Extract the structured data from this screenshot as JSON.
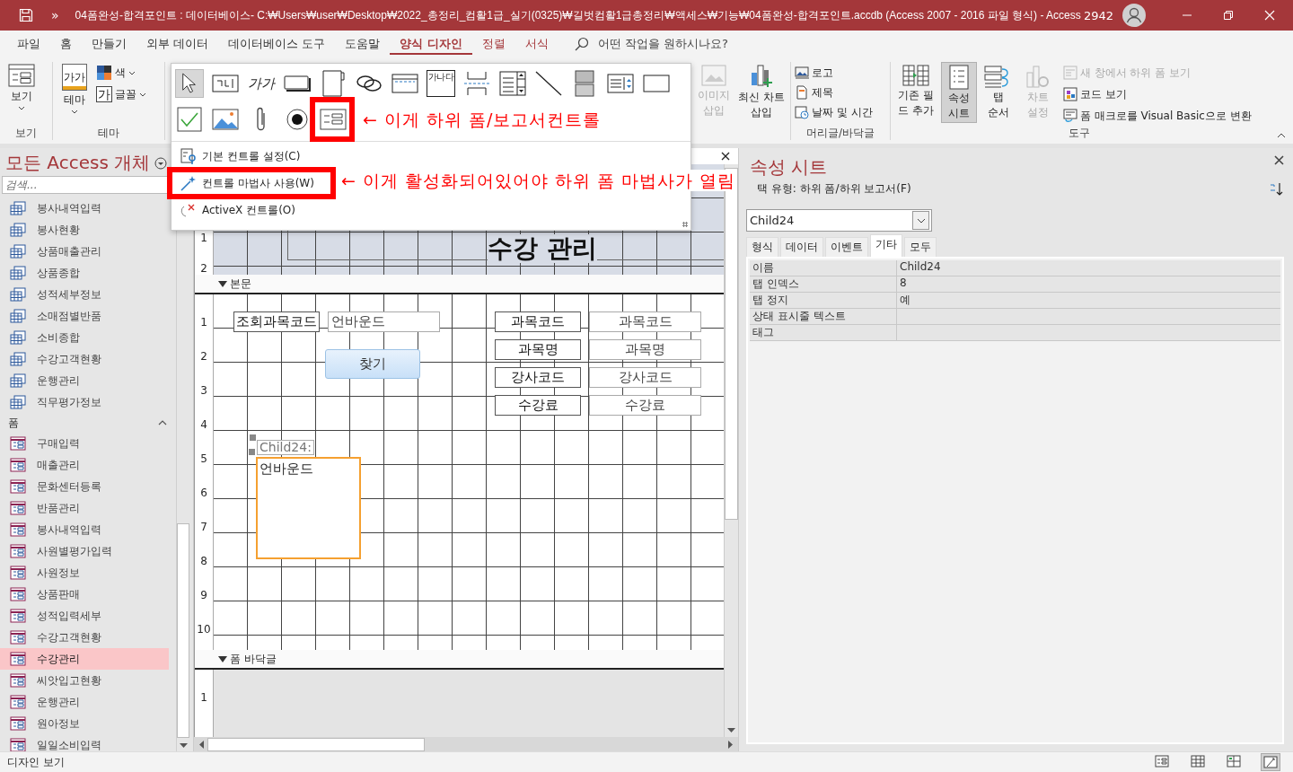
{
  "window": {
    "title": "04폼완성-합격포인트 : 데이터베이스- C:₩Users₩user₩Desktop₩2022_총정리_컴활1급_실기(0325)₩길벗컴활1급총정리₩액세스₩기능₩04폼완성-합격포인트.accdb (Access 2007 - 2016 파일 형식)  -  Access",
    "user_count": "2942",
    "more": "»"
  },
  "menu_tabs": [
    {
      "label": "파일",
      "selected": false,
      "contextual": false
    },
    {
      "label": "홈",
      "selected": false,
      "contextual": false
    },
    {
      "label": "만들기",
      "selected": false,
      "contextual": false
    },
    {
      "label": "외부 데이터",
      "selected": false,
      "contextual": false
    },
    {
      "label": "데이터베이스 도구",
      "selected": false,
      "contextual": false
    },
    {
      "label": "도움말",
      "selected": false,
      "contextual": false
    },
    {
      "label": "양식 디자인",
      "selected": true,
      "contextual": true
    },
    {
      "label": "정렬",
      "selected": false,
      "contextual": true
    },
    {
      "label": "서식",
      "selected": false,
      "contextual": true
    }
  ],
  "tell_me": {
    "placeholder": "어떤 작업을 원하시나요?"
  },
  "ribbon": {
    "view": {
      "button": "보기",
      "label": "보기"
    },
    "theme": {
      "button": "테마",
      "icon_text": "가가",
      "colors": "색",
      "fonts": "글꼴",
      "fonts_icon_text": "가",
      "label": "테마"
    },
    "insert": [
      {
        "lines": [
          "이미지",
          "삽입"
        ],
        "kind": "image",
        "disabled": true
      },
      {
        "lines": [
          "최신 차트",
          "삽입"
        ],
        "kind": "chart",
        "disabled": false
      }
    ],
    "header_footer": {
      "items": [
        {
          "label": "로고",
          "kind": "logo"
        },
        {
          "label": "제목",
          "kind": "title"
        },
        {
          "label": "날짜 및 시간",
          "kind": "date"
        }
      ],
      "label": "머리글/바닥글"
    },
    "tools": {
      "big": [
        {
          "lines": [
            "기존 필",
            "드 추가"
          ],
          "kind": "fields",
          "selected": false,
          "disabled": false
        },
        {
          "lines": [
            "속성",
            "시트"
          ],
          "kind": "sheet",
          "selected": true,
          "disabled": false
        },
        {
          "lines": [
            "탭",
            "순서"
          ],
          "kind": "taborder",
          "selected": false,
          "disabled": false
        },
        {
          "lines": [
            "차트",
            "설정"
          ],
          "kind": "chart",
          "selected": false,
          "disabled": true
        }
      ],
      "small": [
        {
          "label": "새 창에서 하위 폼 보기",
          "kind": "subwin",
          "disabled": true
        },
        {
          "label": "코드 보기",
          "kind": "code",
          "disabled": false
        },
        {
          "label": "폼 매크로를 Visual Basic으로 변환",
          "kind": "convert",
          "disabled": false
        }
      ],
      "label": "도구"
    }
  },
  "controls_popup": {
    "rows": [
      [
        {
          "kind": "pointer",
          "selected": true
        },
        {
          "kind": "label",
          "selected": false
        },
        {
          "kind": "textbox",
          "text": "가가",
          "selected": false
        },
        {
          "kind": "button",
          "selected": false
        },
        {
          "kind": "tab",
          "selected": false
        },
        {
          "kind": "link",
          "selected": false
        },
        {
          "kind": "nav",
          "selected": false
        },
        {
          "kind": "optiongroup",
          "text": "가나다",
          "selected": false
        },
        {
          "kind": "pagebreak",
          "selected": false
        },
        {
          "kind": "combo",
          "selected": false
        },
        {
          "kind": "line",
          "selected": false
        },
        {
          "kind": "toggle",
          "selected": false
        },
        {
          "kind": "listbox",
          "selected": false
        },
        {
          "kind": "rect",
          "selected": false
        }
      ],
      [
        {
          "kind": "checkbox",
          "selected": false
        },
        {
          "kind": "image",
          "selected": false
        },
        {
          "kind": "attachment",
          "selected": false
        },
        {
          "kind": "option",
          "selected": false
        },
        {
          "kind": "subform",
          "selected": false
        }
      ]
    ],
    "menu": [
      {
        "label": "기본 컨트롤 설정(C)",
        "kind": "settings"
      },
      {
        "label": "컨트롤 마법사 사용(W)",
        "kind": "wizard"
      },
      {
        "label": "ActiveX 컨트롤(O)",
        "kind": "activex"
      }
    ]
  },
  "annotations": [
    {
      "text": "← 이게 하위 폼/보고서컨트롤"
    },
    {
      "text": "← 이게 활성화되어있어야 하위 폼 마법사가 열림"
    }
  ],
  "nav": {
    "title": "모든 Access 개체",
    "search": {
      "placeholder": "검색..."
    },
    "groups": [
      {
        "kind": "query",
        "items": [
          {
            "label": "봉사내역입력",
            "selected": false
          },
          {
            "label": "봉사현황",
            "selected": false
          },
          {
            "label": "상품매출관리",
            "selected": false
          },
          {
            "label": "상품종합",
            "selected": false
          },
          {
            "label": "성적세부정보",
            "selected": false
          },
          {
            "label": "소매점별반품",
            "selected": false
          },
          {
            "label": "소비종합",
            "selected": false
          },
          {
            "label": "수강고객현황",
            "selected": false
          },
          {
            "label": "운행관리",
            "selected": false
          },
          {
            "label": "직무평가정보",
            "selected": false
          }
        ]
      },
      {
        "kind": "form",
        "title": "폼",
        "expanded": true,
        "items": [
          {
            "label": "구매입력",
            "selected": false
          },
          {
            "label": "매출관리",
            "selected": false
          },
          {
            "label": "문화센터등록",
            "selected": false
          },
          {
            "label": "반품관리",
            "selected": false
          },
          {
            "label": "봉사내역입력",
            "selected": false
          },
          {
            "label": "사원별평가입력",
            "selected": false
          },
          {
            "label": "사원정보",
            "selected": false
          },
          {
            "label": "상품판매",
            "selected": false
          },
          {
            "label": "성적입력세부",
            "selected": false
          },
          {
            "label": "수강고객현황",
            "selected": false
          },
          {
            "label": "수강관리",
            "selected": true
          },
          {
            "label": "씨앗입고현황",
            "selected": false
          },
          {
            "label": "운행관리",
            "selected": false
          },
          {
            "label": "원아정보",
            "selected": false
          },
          {
            "label": "일일소비입력",
            "selected": false
          }
        ]
      }
    ]
  },
  "design": {
    "header_title": "수강 관리",
    "body_bar": "본문",
    "footer_bar": "폼 바닥글",
    "ruler": {
      "header": [
        "1",
        "2"
      ],
      "body": [
        "1",
        "2",
        "3",
        "4",
        "5",
        "6",
        "7",
        "8",
        "9",
        "10"
      ],
      "footer": [
        "1"
      ]
    },
    "search_label": "조회과목코드",
    "search_value": "언바운드",
    "find_button": "찾기",
    "fields": [
      {
        "label": "과목코드",
        "value": "과목코드"
      },
      {
        "label": "과목명",
        "value": "과목명"
      },
      {
        "label": "강사코드",
        "value": "강사코드"
      },
      {
        "label": "수강료",
        "value": "수강료"
      }
    ],
    "subform": {
      "label": "Child24:",
      "content": "언바운드",
      "selected": true
    }
  },
  "property_sheet": {
    "title": "속성 시트",
    "selection_type": "택 유형: 하위 폼/하위 보고서(F)",
    "object": "Child24",
    "tabs": [
      {
        "label": "형식",
        "selected": false
      },
      {
        "label": "데이터",
        "selected": false
      },
      {
        "label": "이벤트",
        "selected": false
      },
      {
        "label": "기타",
        "selected": true
      },
      {
        "label": "모두",
        "selected": false
      }
    ],
    "rows": [
      {
        "name": "이름",
        "value": "Child24"
      },
      {
        "name": "탭 인덱스",
        "value": "8"
      },
      {
        "name": "탭 정지",
        "value": "예"
      },
      {
        "name": "상태 표시줄 텍스트",
        "value": ""
      },
      {
        "name": "태그",
        "value": ""
      }
    ]
  },
  "status_bar": {
    "text": "디자인 보기",
    "views": [
      {
        "kind": "form",
        "selected": false
      },
      {
        "kind": "datasheet",
        "selected": false
      },
      {
        "kind": "layout",
        "selected": false
      },
      {
        "kind": "design",
        "selected": true
      }
    ]
  }
}
